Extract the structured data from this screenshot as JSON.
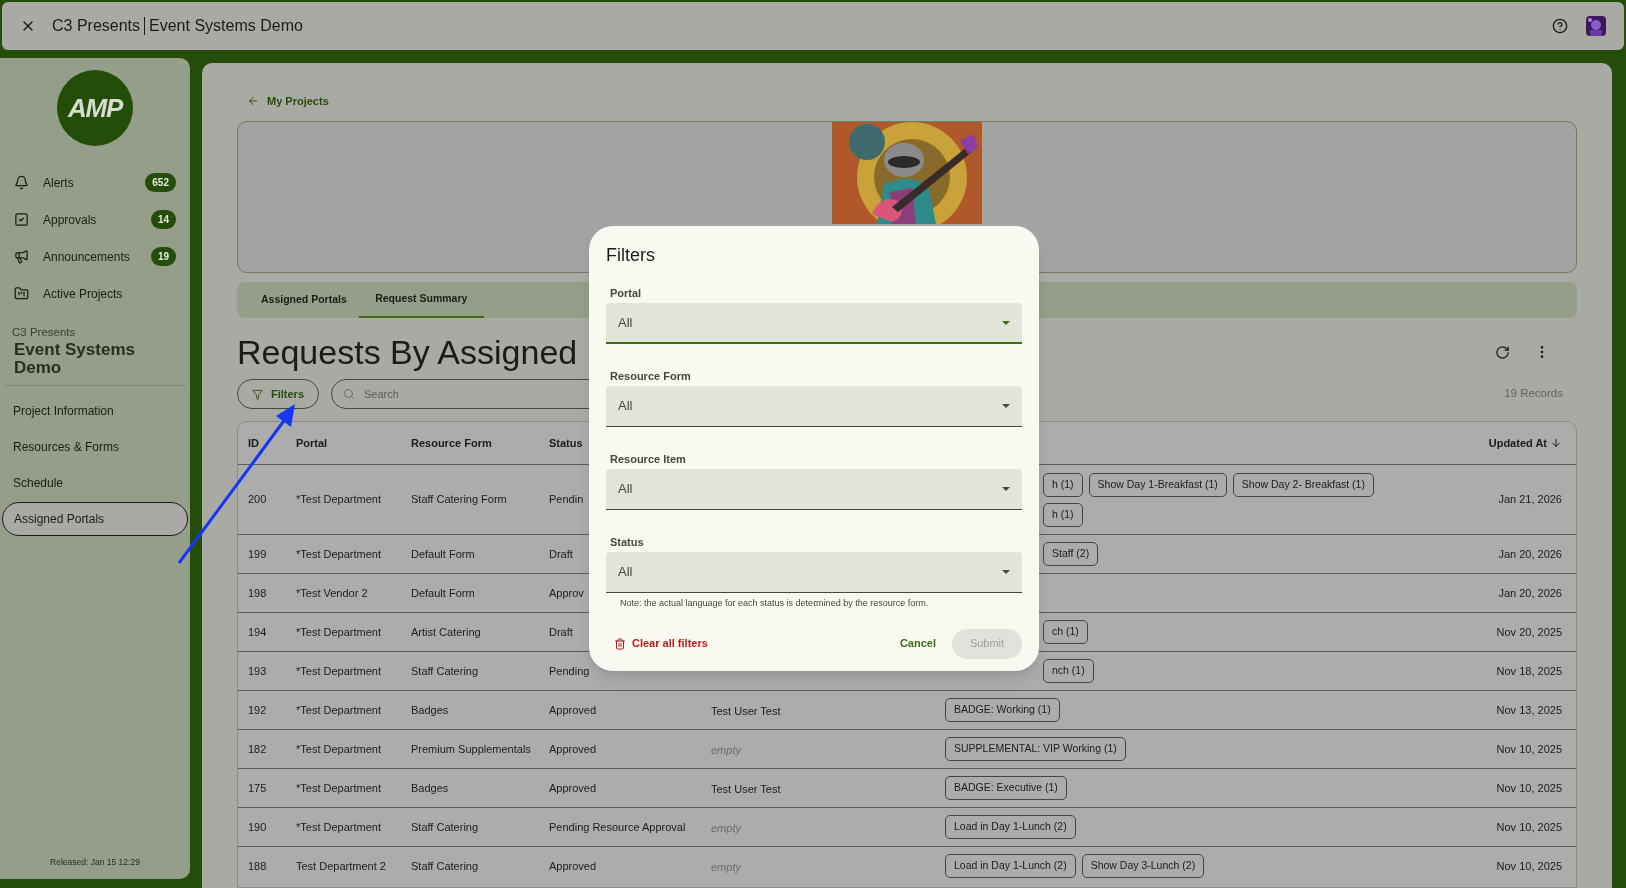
{
  "window": {
    "title_org": "C3 Presents",
    "title_project": "Event Systems Demo"
  },
  "logo": {
    "text": "AMP"
  },
  "sidebar": {
    "items": [
      {
        "kind": "bell",
        "label": "Alerts",
        "count": "652"
      },
      {
        "kind": "check",
        "label": "Approvals",
        "count": "14"
      },
      {
        "kind": "megaphone",
        "label": "Announcements",
        "count": "19"
      },
      {
        "kind": "projects",
        "label": "Active Projects"
      }
    ],
    "org": "C3 Presents",
    "project": "Event Systems Demo",
    "nav": [
      {
        "label": "Project Information",
        "selected": false
      },
      {
        "label": "Resources & Forms",
        "selected": false
      },
      {
        "label": "Schedule",
        "selected": false
      },
      {
        "label": "Assigned Portals",
        "selected": true
      }
    ],
    "released": "Released: Jan 15 12:29"
  },
  "back_link": "My Projects",
  "tabs": [
    {
      "label": "Assigned Portals",
      "selected": false
    },
    {
      "label": "Request Summary",
      "selected": true
    }
  ],
  "heading": "Requests By Assigned",
  "filters_button": "Filters",
  "search": {
    "placeholder": "Search"
  },
  "records": "19 Records",
  "table": {
    "columns": [
      "ID",
      "Portal",
      "Resource Form",
      "Status"
    ],
    "sort_column": "Updated At",
    "rows": [
      {
        "id": "200",
        "portal": "*Test Department",
        "form": "Staff Catering Form",
        "status": "Pendin",
        "covered": true,
        "tag_lines": [
          [
            "h (1)",
            "Show Day 1-Breakfast (1)",
            "Show Day 2- Breakfast (1)"
          ],
          [
            "h (1)"
          ]
        ],
        "updated": "Jan 21, 2026"
      },
      {
        "id": "199",
        "portal": "*Test Department",
        "form": "Default Form",
        "status": "Draft",
        "covered": true,
        "tag_lines": [
          [
            "Staff (2)"
          ]
        ],
        "updated": "Jan 20, 2026"
      },
      {
        "id": "198",
        "portal": "*Test Vendor 2",
        "form": "Default Form",
        "status": "Approv",
        "tag_lines": [],
        "updated": "Jan 20, 2026"
      },
      {
        "id": "194",
        "portal": "*Test Department",
        "form": "Artist Catering",
        "status": "Draft",
        "covered": true,
        "tag_lines": [
          [
            "ch (1)"
          ]
        ],
        "updated": "Nov 20, 2025"
      },
      {
        "id": "193",
        "portal": "*Test Department",
        "form": "Staff Catering",
        "status": "Pending",
        "covered": true,
        "tag_lines": [
          [
            "nch (1)"
          ]
        ],
        "updated": "Nov 18, 2025"
      },
      {
        "id": "192",
        "portal": "*Test Department",
        "form": "Badges",
        "status": "Approved",
        "covered": false,
        "user": {
          "text": "Test User Test",
          "empty": false
        },
        "tag_lines": [
          [
            "BADGE: Working (1)"
          ]
        ],
        "updated": "Nov 13, 2025"
      },
      {
        "id": "182",
        "portal": "*Test Department",
        "form": "Premium Supplementals",
        "status": "Approved",
        "covered": false,
        "user": {
          "text": "empty",
          "empty": true
        },
        "tag_lines": [
          [
            "SUPPLEMENTAL: VIP Working (1)"
          ]
        ],
        "updated": "Nov 10, 2025"
      },
      {
        "id": "175",
        "portal": "*Test Department",
        "form": "Badges",
        "status": "Approved",
        "covered": false,
        "user": {
          "text": "Test User Test",
          "empty": false
        },
        "tag_lines": [
          [
            "BADGE: Executive (1)"
          ]
        ],
        "updated": "Nov 10, 2025"
      },
      {
        "id": "190",
        "portal": "*Test Department",
        "form": "Staff Catering",
        "status": "Pending Resource Approval",
        "covered": false,
        "user": {
          "text": "empty",
          "empty": true
        },
        "tag_lines": [
          [
            "Load in Day 1-Lunch (2)"
          ]
        ],
        "updated": "Nov 10, 2025"
      },
      {
        "id": "188",
        "portal": "Test Department 2",
        "form": "Staff Catering",
        "status": "Approved",
        "covered": false,
        "user": {
          "text": "empty",
          "empty": true
        },
        "tag_lines": [
          [
            "Load in Day 1-Lunch (2)",
            "Show Day 3-Lunch (2)"
          ]
        ],
        "updated": "Nov 10, 2025"
      }
    ]
  },
  "dialog": {
    "title": "Filters",
    "fields": [
      {
        "label": "Portal",
        "value": "All",
        "focused": true
      },
      {
        "label": "Resource Form",
        "value": "All",
        "focused": false
      },
      {
        "label": "Resource Item",
        "value": "All",
        "focused": false
      },
      {
        "label": "Status",
        "value": "All",
        "focused": false
      }
    ],
    "note": "Note: the actual language for each status is determined by the resource form.",
    "clear": "Clear all filters",
    "cancel": "Cancel",
    "submit": {
      "label": "Submit",
      "disabled": true
    }
  }
}
